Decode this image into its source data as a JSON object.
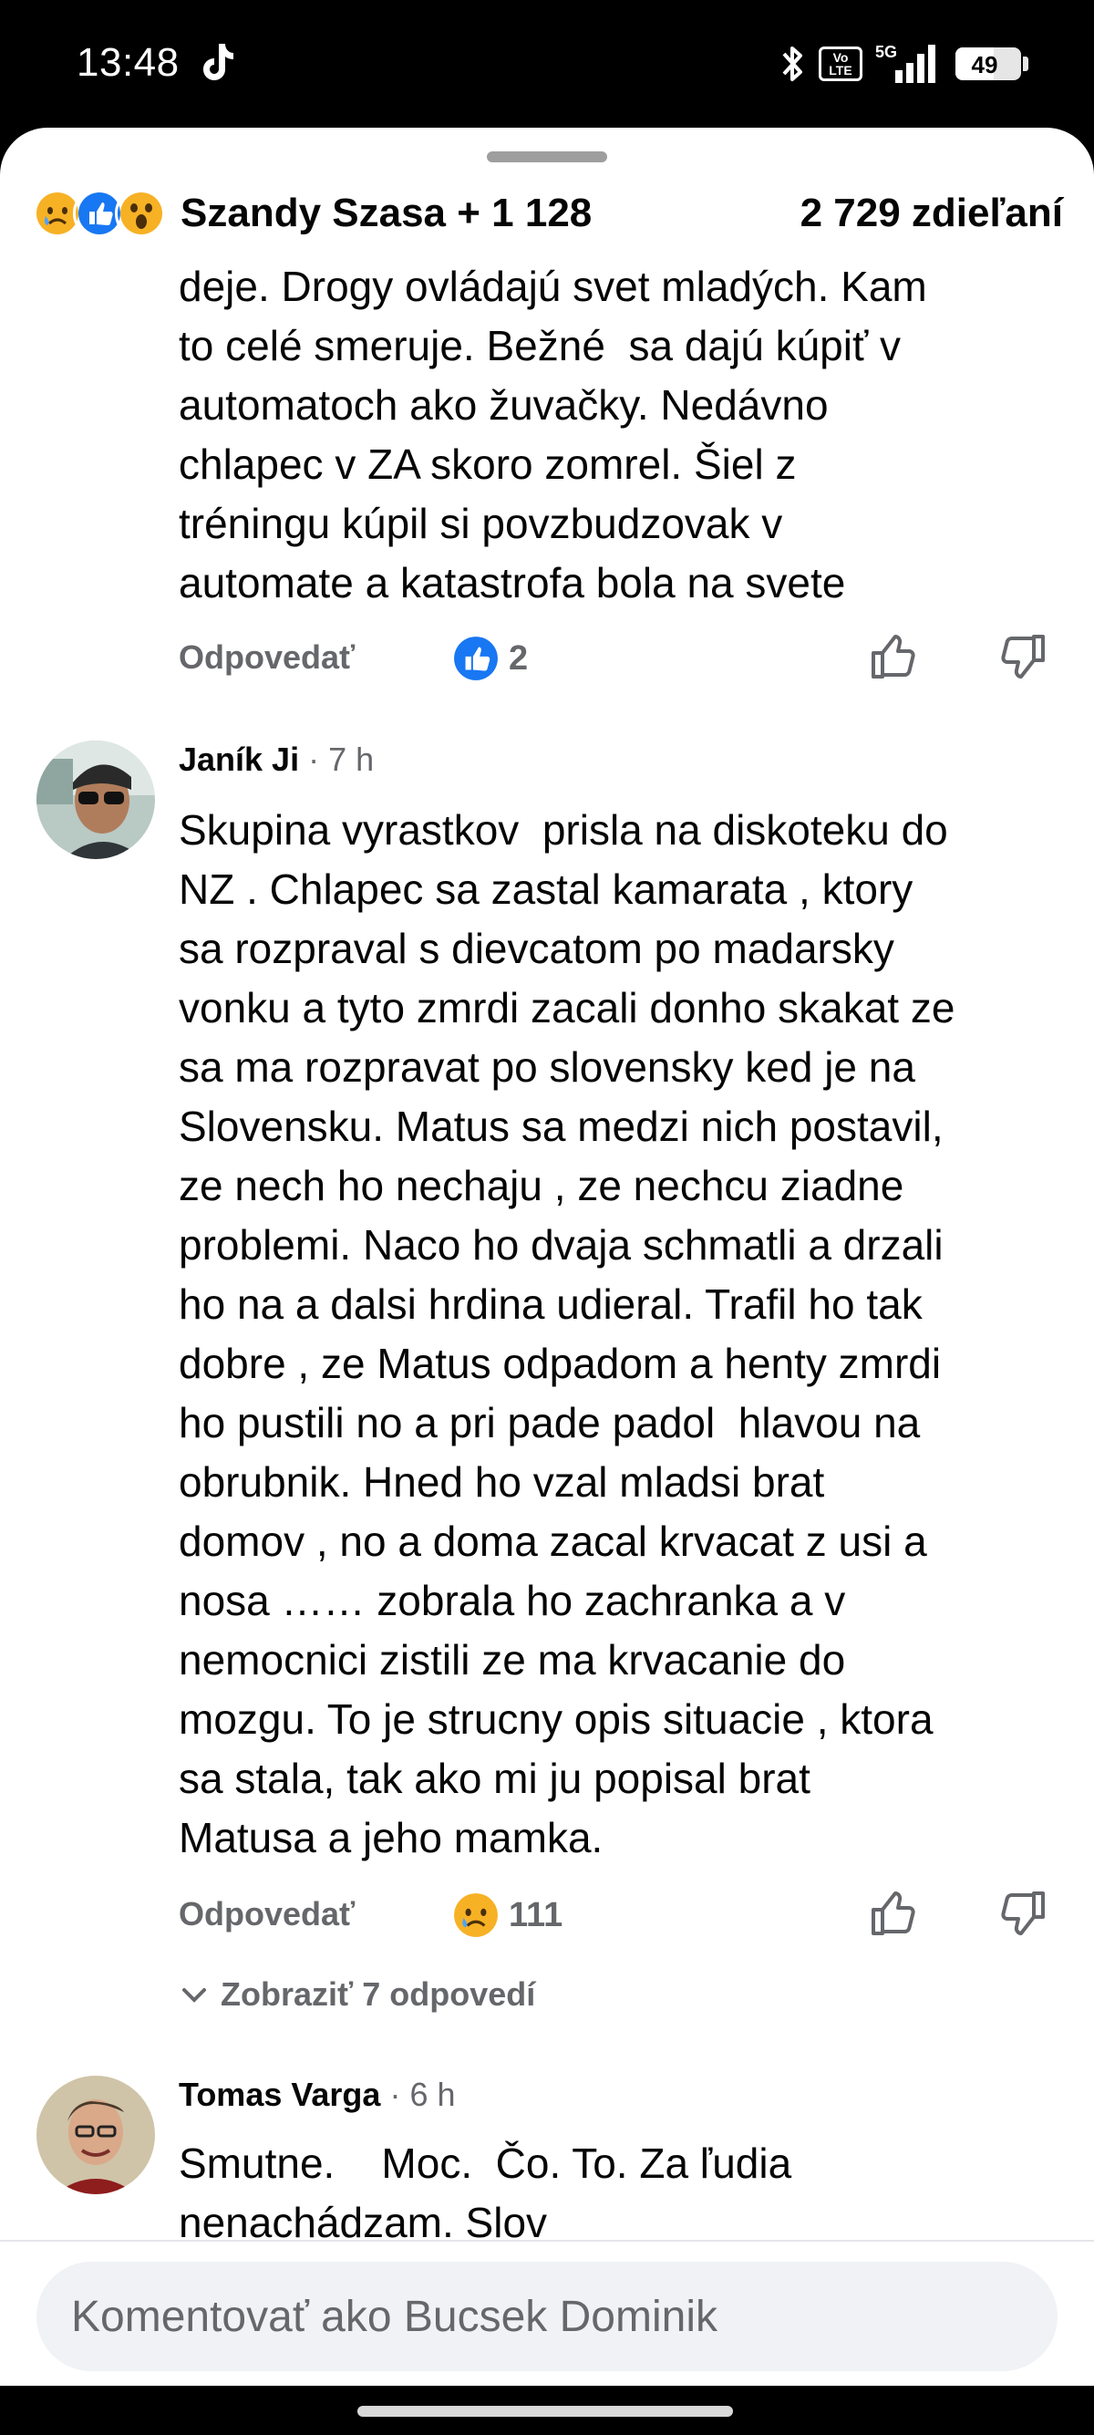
{
  "status_bar": {
    "time": "13:48",
    "network_5g": "5G",
    "volte": "Vo LTE",
    "battery": "49",
    "icons": [
      "tiktok-icon",
      "bluetooth-icon",
      "volte-icon",
      "signal-icon",
      "battery-icon"
    ]
  },
  "summary": {
    "reactors": "Szandy Szasa + 1 128",
    "shares": "2 729 zdieľaní",
    "reaction_icons": [
      "sad-reaction-icon",
      "like-reaction-icon",
      "wow-reaction-icon"
    ]
  },
  "comments": [
    {
      "text": "deje. Drogy ovládajú svet mladých. Kam\nto celé smeruje. Bežné  sa dajú kúpiť v\nautomatoch ako žuvačky. Nedávno\nchlapec v ZA skoro zomrel. Šiel z\ntréningu kúpil si povzbudzovak v\nautomate a katastrofa bola na svete",
      "reply_label": "Odpovedať",
      "reaction_count": "2",
      "reaction_icon": "like-reaction-icon"
    },
    {
      "author": "Janík Ji",
      "time": "· 7 h",
      "text": "Skupina vyrastkov  prisla na diskoteku do\nNZ . Chlapec sa zastal kamarata , ktory\nsa rozpraval s dievcatom po madarsky\nvonku a tyto zmrdi zacali donho skakat ze\nsa ma rozpravat po slovensky ked je na\nSlovensku. Matus sa medzi nich postavil,\nze nech ho nechaju , ze nechcu ziadne\nproblemi. Naco ho dvaja schmatli a drzali\nho na a dalsi hrdina udieral. Trafil ho tak\ndobre , ze Matus odpadom a henty zmrdi\nho pustili no a pri pade padol  hlavou na\nobrubnik. Hned ho vzal mladsi brat\ndomov , no a doma zacal krvacat z usi a\nnosa …… zobrala ho zachranka a v\nnemocnici zistili ze ma krvacanie do\nmozgu. To je strucny opis situacie , ktora\nsa stala, tak ako mi ju popisal brat\nMatusa a jeho mamka.",
      "reply_label": "Odpovedať",
      "reaction_count": "111",
      "reaction_icon": "sad-reaction-icon",
      "view_replies": "Zobraziť 7 odpovedí"
    },
    {
      "author": "Tomas Varga",
      "time": "· 6 h",
      "text": "Smutne.    Moc.  Čo. To. Za ľudia\nnenachádzam. Slov"
    }
  ],
  "composer": {
    "placeholder": "Komentovať ako Bucsek Dominik"
  },
  "colors": {
    "facebook_blue": "#1877f2",
    "secondary_text": "#65676b",
    "reaction_yellow": "#f7b125"
  }
}
